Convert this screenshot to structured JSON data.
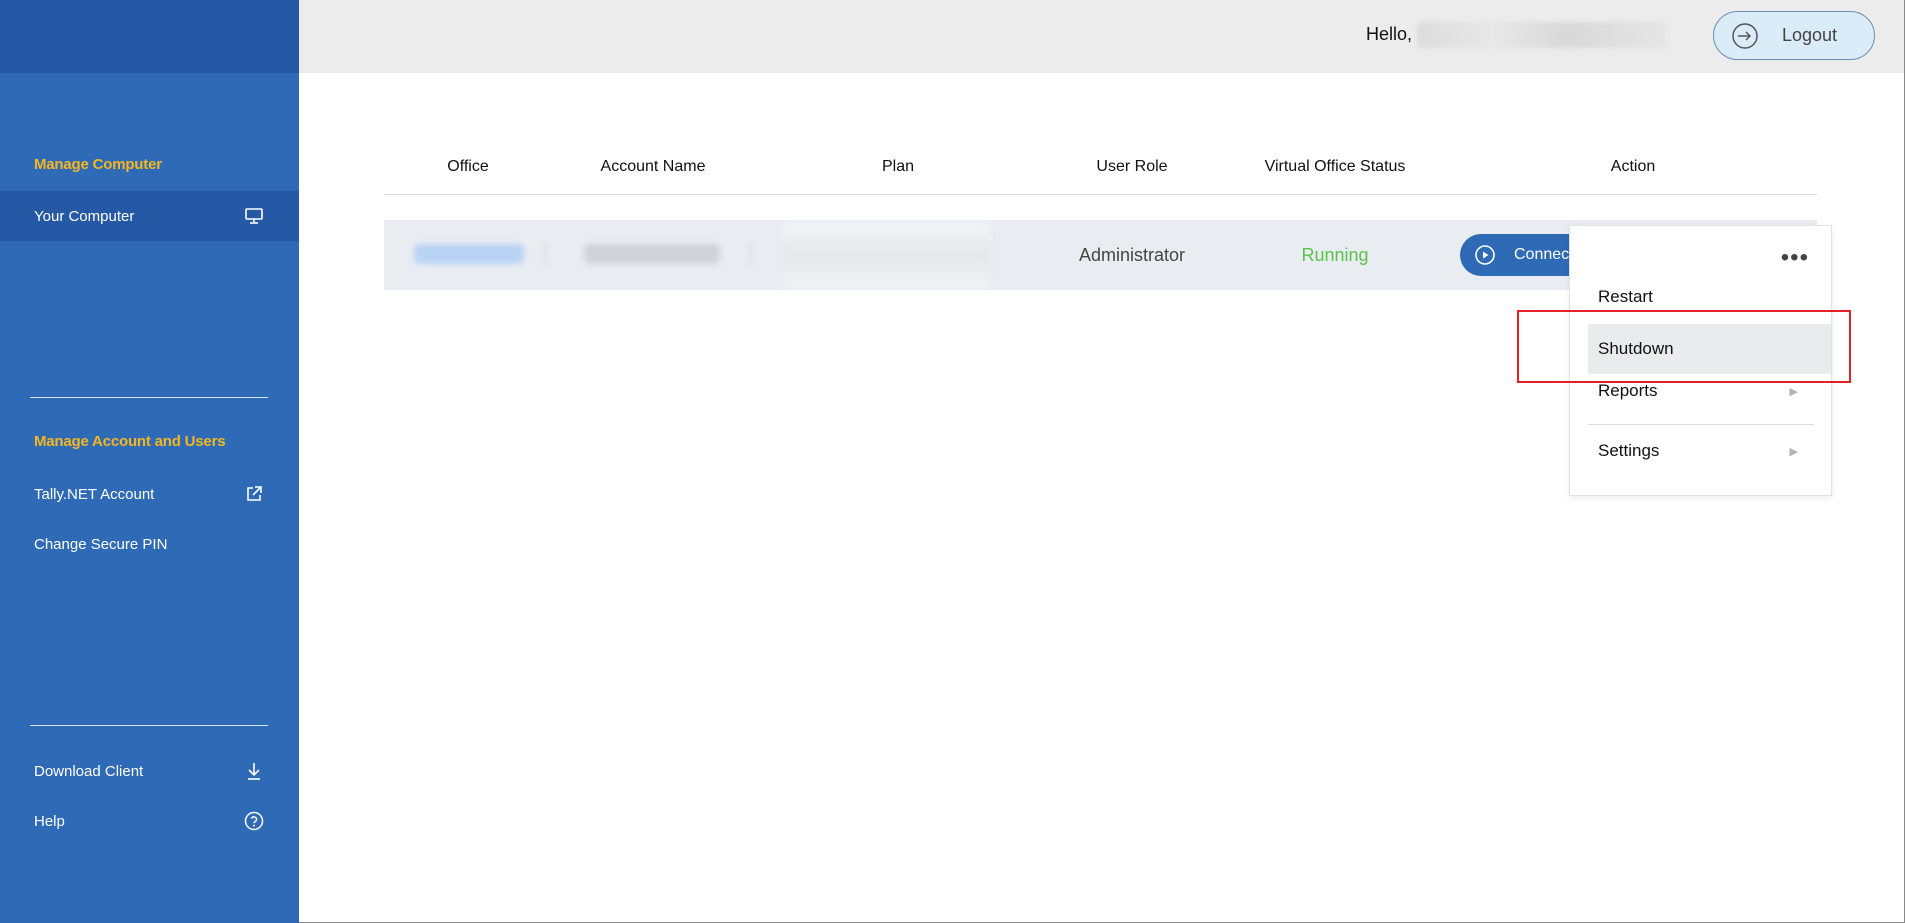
{
  "header": {
    "greeting": "Hello,",
    "logout_label": "Logout"
  },
  "sidebar": {
    "section_computer": "Manage Computer",
    "item_your_computer": "Your Computer",
    "section_account": "Manage Account and Users",
    "item_tally_account": "Tally.NET Account",
    "item_change_pin": "Change Secure PIN",
    "item_download_client": "Download Client",
    "item_help": "Help"
  },
  "table": {
    "columns": [
      "Office",
      "Account Name",
      "Plan",
      "User Role",
      "Virtual Office Status",
      "Action"
    ],
    "row": {
      "user_role": "Administrator",
      "status": "Running",
      "connect_label": "Connect"
    }
  },
  "menu": {
    "dots": "•••",
    "items": [
      "Restart",
      "Shutdown",
      "Reports",
      "Settings"
    ],
    "submenu_arrow": "▶"
  },
  "colors": {
    "sidebar": "#2f6ab6",
    "sidebar_dark": "#2559a6",
    "section_heading": "#f5b71f",
    "status_running": "#5cc24a",
    "highlight_box": "#e52026"
  }
}
